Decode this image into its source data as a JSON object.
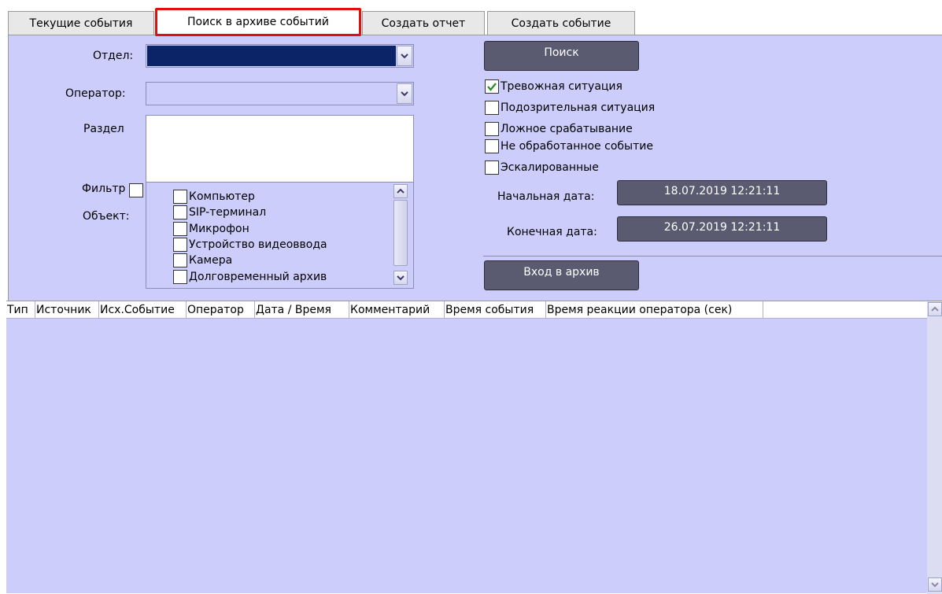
{
  "tabs": [
    {
      "label": "Текущие события"
    },
    {
      "label": "Поиск в архиве событий"
    },
    {
      "label": "Создать отчет"
    },
    {
      "label": "Создать событие"
    }
  ],
  "form": {
    "department_label": "Отдел:",
    "operator_label": "Оператор:",
    "section_label": "Раздел",
    "filter_label": "Фильтр",
    "object_label": "Объект:",
    "objects": [
      {
        "label": "Компьютер"
      },
      {
        "label": "SIP-терминал"
      },
      {
        "label": "Микрофон"
      },
      {
        "label": "Устройство видеоввода"
      },
      {
        "label": "Камера"
      },
      {
        "label": "Долговременный архив"
      }
    ]
  },
  "search": {
    "button_label": "Поиск",
    "status_options": [
      {
        "label": "Тревожная ситуация",
        "checked": true
      },
      {
        "label": "Подозрительная ситуация",
        "checked": false
      },
      {
        "label": "Ложное срабатывание",
        "checked": false
      },
      {
        "label": "Не обработанное событие",
        "checked": false
      },
      {
        "label": "Эскалированные",
        "checked": false
      }
    ],
    "start_date_label": "Начальная дата:",
    "start_date_value": "18.07.2019 12:21:11",
    "end_date_label": "Конечная дата:",
    "end_date_value": "26.07.2019 12:21:11",
    "archive_button_label": "Вход в архив"
  },
  "table": {
    "columns": [
      "Тип",
      "Источник",
      "Исх.Событие",
      "Оператор",
      "Дата / Время",
      "Комментарий",
      "Время события",
      "Время реакции оператора (сек)"
    ]
  },
  "colors": {
    "panel_bg": "#cccdfb",
    "dark_button": "#5a5a70",
    "selected_field": "#0a2467",
    "active_tab_outline": "#e01010",
    "check_mark": "#2a8a2a"
  }
}
